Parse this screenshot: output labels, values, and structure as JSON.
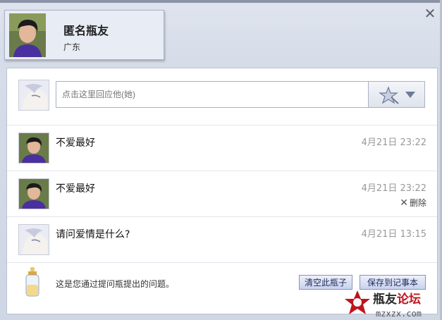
{
  "header": {
    "name": "匿名瓶友",
    "location": "广东",
    "close_icon": "close-icon"
  },
  "reply": {
    "placeholder": "点击这里回应他(她)",
    "emoji_icon": "magic-wand-star-icon",
    "dropdown_icon": "triangle-down-icon"
  },
  "messages": [
    {
      "text": "不爱最好",
      "time": "4月21日 23:22",
      "delete_label": ""
    },
    {
      "text": "不爱最好",
      "time": "4月21日 23:22",
      "delete_label": "删除"
    },
    {
      "text": "请问爱情是什么?",
      "time": "4月21日 13:15",
      "delete_label": ""
    }
  ],
  "footer": {
    "info": "这是您通过提问瓶提出的问题。",
    "clear_button": "清空此瓶子",
    "save_button": "保存到记事本",
    "bottle_icon": "baby-bottle-icon"
  },
  "watermark": {
    "title": "瓶友论坛",
    "url": "mzxzx.com"
  },
  "colors": {
    "panel_bg": "#ffffff",
    "header_bg": "#e8ecf5",
    "button_border": "#8793b6",
    "time_text": "#999999"
  }
}
